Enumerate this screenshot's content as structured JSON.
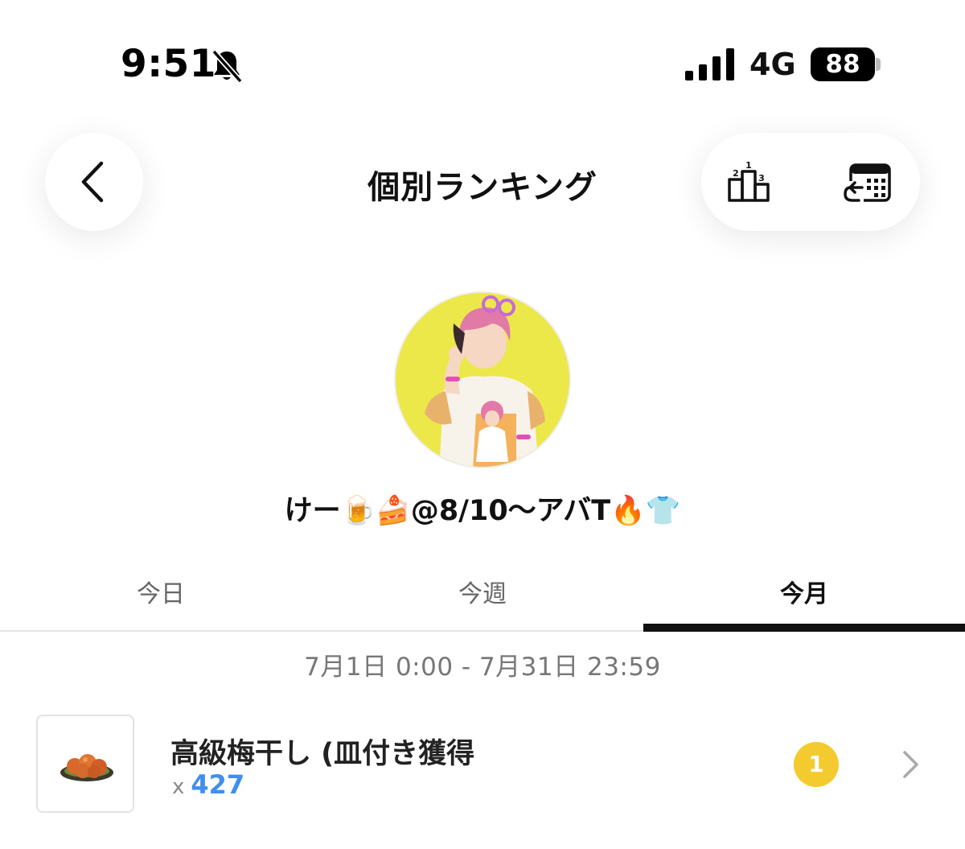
{
  "status_bar": {
    "time": "9:51",
    "network": "4G",
    "battery": "88"
  },
  "header": {
    "title": "個別ランキング"
  },
  "profile": {
    "name": "けー🍺🍰@8/10～アバT🔥👕"
  },
  "tabs": [
    {
      "label": "今日",
      "active": false
    },
    {
      "label": "今週",
      "active": false
    },
    {
      "label": "今月",
      "active": true
    }
  ],
  "date_range": "7月1日 0:00 - 7月31日 23:59",
  "gifts": [
    {
      "name": "高級梅干し (皿付き獲得",
      "count_prefix": "x",
      "count": "427",
      "rank": "1"
    }
  ],
  "colors": {
    "accent_blue": "#3f8ef0",
    "rank_gold": "#f4cb2e",
    "avatar_bg": "#ece84a"
  },
  "icons": [
    "bell-slash-icon",
    "signal-icon",
    "chevron-left-icon",
    "podium-icon",
    "calendar-history-icon",
    "chevron-right-icon"
  ]
}
